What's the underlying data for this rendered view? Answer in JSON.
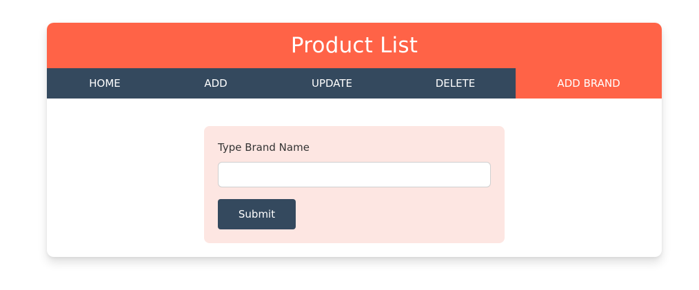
{
  "header": {
    "title": "Product List"
  },
  "nav": {
    "items": [
      {
        "label": "HOME"
      },
      {
        "label": "ADD"
      },
      {
        "label": "UPDATE"
      },
      {
        "label": "DELETE"
      },
      {
        "label": "ADD BRAND",
        "active": true
      }
    ]
  },
  "form": {
    "label": "Type Brand Name",
    "input_value": "",
    "input_placeholder": "",
    "submit_label": "Submit"
  },
  "colors": {
    "accent": "#ff6347",
    "nav_background": "#34495e",
    "form_background": "#fde6e2",
    "button_background": "#34495e"
  }
}
